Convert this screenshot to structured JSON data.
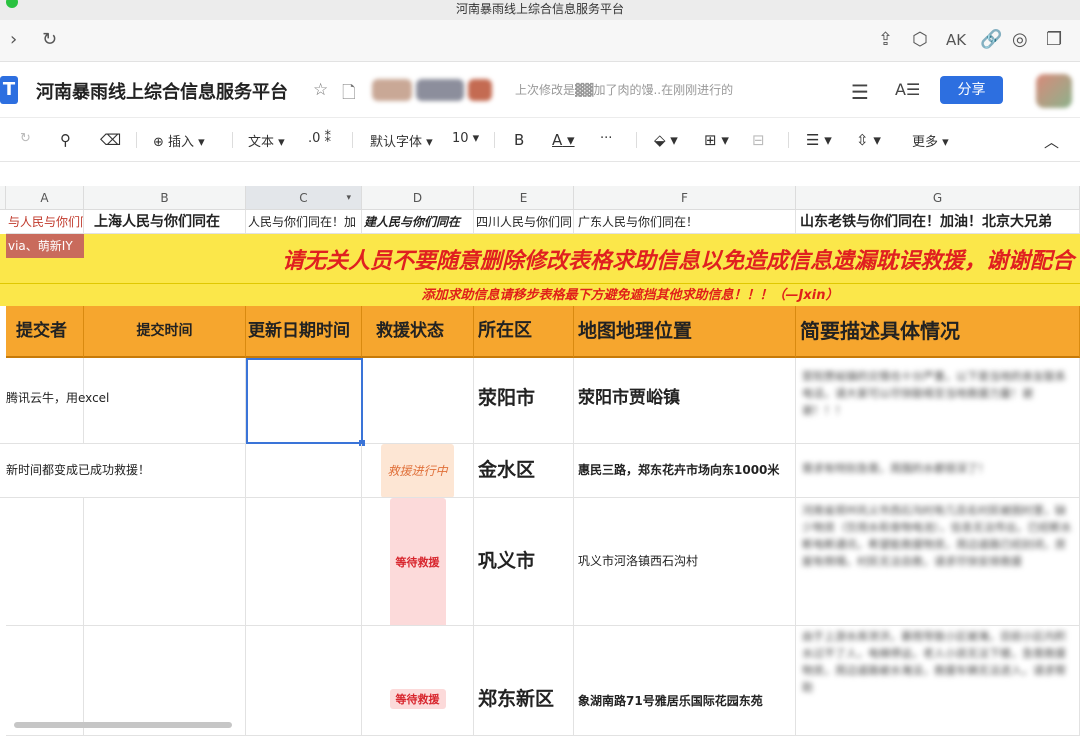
{
  "window": {
    "title": "河南暴雨线上综合信息服务平台"
  },
  "doc": {
    "title": "河南暴雨线上综合信息服务平台",
    "last_modified": "上次修改是▓▓加了肉的馒..在刚刚进行的",
    "share_label": "分享"
  },
  "toolbar": {
    "insert": "插入",
    "text": "文本",
    "decimal": ".0",
    "font": "默认字体",
    "size": "10",
    "bold": "B",
    "underline_a": "A",
    "more_dots": "···",
    "more": "更多"
  },
  "columns": [
    "A",
    "B",
    "C",
    "D",
    "E",
    "F",
    "G"
  ],
  "row1": [
    "与人民与你们同",
    "上海人民与你们同在",
    "人民与你们同在！加",
    "建人民与你们同在",
    "四川人民与你们同",
    "广东人民与你们同在！",
    "山东老铁与你们同在！加油！北京大兄弟"
  ],
  "via_note": "via、萌新IY",
  "banner_main": "请无关人员不要随意删除修改表格求助信息以免造成信息遗漏耽误救援，谢谢配合",
  "banner_sub": "添加求助信息请移步表格最下方避免遮挡其他求助信息！！！（—Jxin）",
  "headers": [
    "提交者",
    "提交时间",
    "更新日期时间",
    "救援状态",
    "所在区",
    "地图地理位置",
    "简要描述具体情况"
  ],
  "rows": [
    {
      "submitter": "腾讯云牛，用excel",
      "status": "",
      "district": "荥阳市",
      "location": "荥阳市贾峪镇",
      "desc": "荥阳贾峪镇的灾情也十分严重，以下是当地的亲友联系电话，请大家可以尽快联络至当地救援力量！谢谢！！！"
    },
    {
      "submitter": "新时间都变成已成功救援！",
      "status": "救援进行中",
      "district": "金水区",
      "location": "惠民三路，郑东花卉市场向东1000米",
      "desc": "需求有特别急需，周围的水都很深了！"
    },
    {
      "submitter": "",
      "status": "等待救援",
      "district": "巩义市",
      "location": "巩义市河洛镇西石沟村",
      "desc": "河南省郑州巩义市西石沟村有几百名村民被困村里，缺少物资（饮用水和食物电池），信息无法传出，已经断水断电断通讯，希望能救援物资，周边道路已经封闭，房屋有倒塌，村民无法自救，请求尽快安排救援"
    },
    {
      "submitter": "",
      "status": "等待救援",
      "district": "郑东新区",
      "location": "象湖南路71号雅居乐国际花园东苑",
      "desc": "由于上游水库泄洪，暴雨导致小区被淹，目前小区内积水过不了人，电梯停运，老人小孩无法下楼，急需救援物资，周边道路被水淹没，救援车辆无法进入，请求帮助"
    }
  ]
}
